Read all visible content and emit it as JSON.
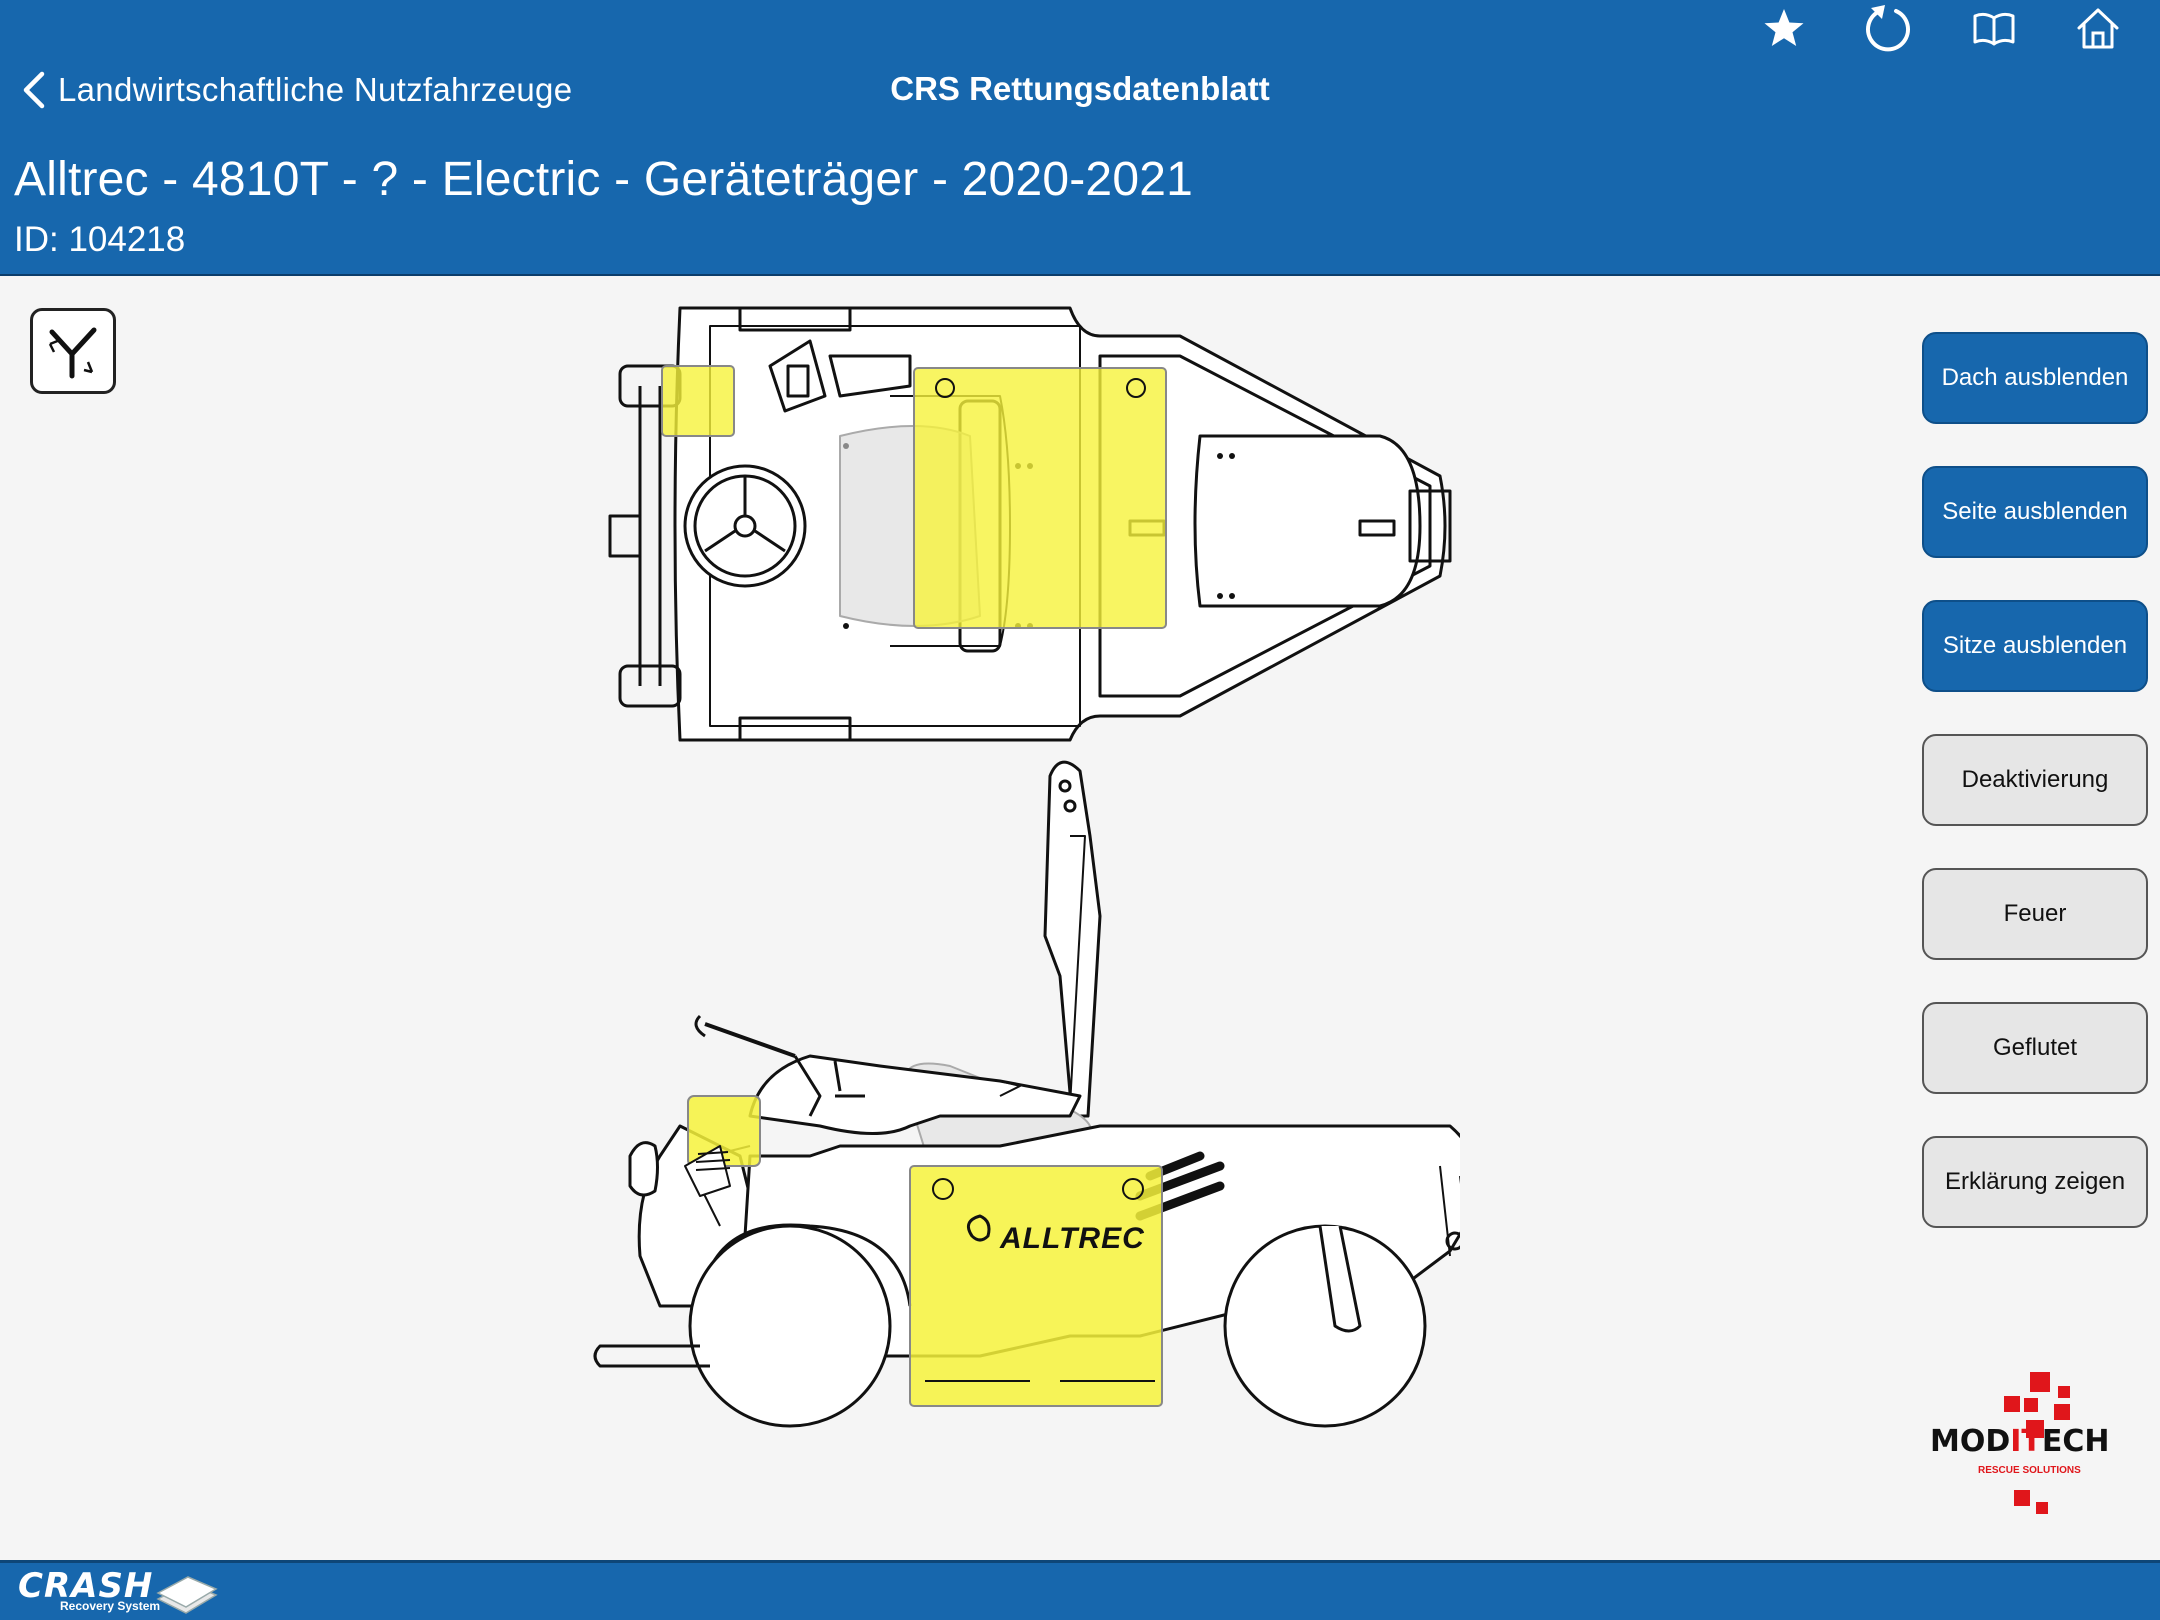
{
  "navbar": {
    "back_label": "Landwirtschaftliche Nutzfahrzeuge",
    "title": "CRS Rettungsdatenblatt",
    "icons": [
      "star-icon",
      "refresh-icon",
      "book-icon",
      "home-icon"
    ]
  },
  "header": {
    "vehicle_title": "Alltrec - 4810T - ? - Electric - Geräteträger - 2020-2021",
    "vehicle_id": "ID: 104218"
  },
  "diagram": {
    "brand_text": "ALLTREC",
    "highlight_color": "#f6f23b"
  },
  "side_buttons": [
    {
      "label": "Dach ausblenden",
      "style": "blue"
    },
    {
      "label": "Seite ausblenden",
      "style": "blue"
    },
    {
      "label": "Sitze ausblenden",
      "style": "blue"
    },
    {
      "label": "Deaktivierung",
      "style": "gray"
    },
    {
      "label": "Feuer",
      "style": "gray"
    },
    {
      "label": "Geflutet",
      "style": "gray"
    },
    {
      "label": "Erklärung zeigen",
      "style": "gray"
    }
  ],
  "moditech_logo": {
    "text_part1": "MOD",
    "text_part2": "IT",
    "text_part3": "ECH",
    "tagline": "RESCUE SOLUTIONS"
  },
  "footer": {
    "logo_word": "CRASH",
    "logo_sub": "Recovery System"
  },
  "colors": {
    "primary_blue": "#1767ad",
    "highlight_yellow": "#f6f23b",
    "logo_red": "#e0161b"
  }
}
